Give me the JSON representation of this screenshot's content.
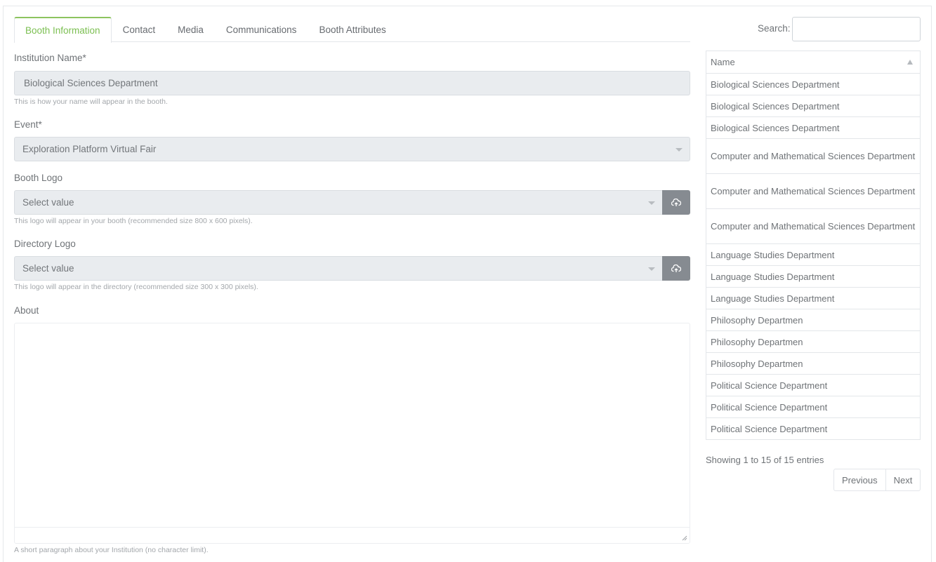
{
  "tabs": [
    {
      "label": "Booth Information",
      "active": true
    },
    {
      "label": "Contact"
    },
    {
      "label": "Media"
    },
    {
      "label": "Communications"
    },
    {
      "label": "Booth Attributes"
    }
  ],
  "form": {
    "institution": {
      "label": "Institution Name*",
      "value": "Biological Sciences Department",
      "help": "This is how your name will appear in the booth."
    },
    "event": {
      "label": "Event*",
      "value": "Exploration Platform Virtual Fair"
    },
    "booth_logo": {
      "label": "Booth Logo",
      "placeholder": "Select value",
      "help": "This logo will appear in your booth (recommended size 800 x 600 pixels)."
    },
    "directory_logo": {
      "label": "Directory Logo",
      "placeholder": "Select value",
      "help": "This logo will appear in the directory (recommended size 300 x 300 pixels)."
    },
    "about": {
      "label": "About",
      "value": "",
      "help": "A short paragraph about your Institution (no character limit)."
    }
  },
  "list": {
    "search_label": "Search:",
    "search_value": "",
    "column_header": "Name",
    "rows": [
      "Biological Sciences Department",
      "Biological Sciences Department",
      "Biological Sciences Department",
      "Computer and Mathematical Sciences Department",
      "Computer and Mathematical Sciences Department",
      "Computer and Mathematical Sciences Department",
      "Language Studies Department",
      "Language Studies Department",
      "Language Studies Department",
      "Philosophy Departmen",
      "Philosophy Departmen",
      "Philosophy Departmen",
      "Political Science Department",
      "Political Science Department",
      "Political Science Department"
    ],
    "info": "Showing 1 to 15 of 15 entries",
    "prev_label": "Previous",
    "next_label": "Next"
  },
  "colors": {
    "accent": "#7bbf51",
    "upload_button": "#868b91",
    "field_bg": "#e9ecef"
  }
}
